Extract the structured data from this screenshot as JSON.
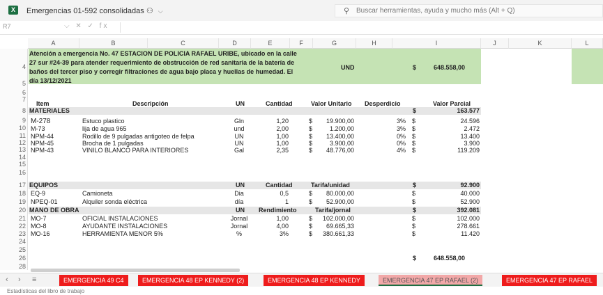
{
  "app": {
    "icon": "excel-icon",
    "doc_title": "Emergencias 01-592 consolidadas",
    "sync_icon": "people-sync-icon",
    "search_placeholder": "Buscar herramientas, ayuda y mucho más (Alt + Q)",
    "name_box": "R7",
    "formula_buttons": "⌵ ✕ ✓ fx"
  },
  "columns": [
    "A",
    "B",
    "C",
    "D",
    "E",
    "F",
    "G",
    "H",
    "I",
    "J",
    "K",
    "L"
  ],
  "rows": [
    "4",
    "5",
    "6",
    "7",
    "8",
    "9",
    "10",
    "11",
    "12",
    "13",
    "14",
    "15",
    "16",
    "17",
    "18",
    "19",
    "20",
    "21",
    "22",
    "23",
    "24",
    "25",
    "26",
    "28"
  ],
  "header_block": {
    "description": "Atención a emergencia No. 47 ESTACION DE POLICIA RAFAEL URIBE, ubicado en la calle 27 sur #24-39 para atender requerimiento de obstrucción de red sanitaria de la batería de baños del tercer piso y corregir filtraciones de agua bajo placa y huellas de humedad. El día 13/12/2021",
    "unit": "UND",
    "currency": "$",
    "total": "648.558,00"
  },
  "table_headers": {
    "item": "Item",
    "descripcion": "Descripción",
    "un": "UN",
    "cantidad": "Cantidad",
    "valor_unitario": "Valor Unitario",
    "desperdicio": "Desperdicio",
    "valor_parcial": "Valor Parcial"
  },
  "materiales": {
    "title": "MATERIALES",
    "currency": "$",
    "subtotal": "163.577",
    "items": [
      {
        "item": "M-278",
        "desc": "Estuco plastico",
        "un": "Gln",
        "cant": "1,20",
        "cur": "$",
        "vu": "19.900,00",
        "desp": "3%",
        "cur2": "$",
        "vp": "24.596"
      },
      {
        "item": "M-73",
        "desc": "lija de agua 965",
        "un": "und",
        "cant": "2,00",
        "cur": "$",
        "vu": "1.200,00",
        "desp": "3%",
        "cur2": "$",
        "vp": "2.472"
      },
      {
        "item": "NPM-44",
        "desc": "Rodillo de 9 pulgadas antigoteo de felpa",
        "un": "UN",
        "cant": "1,00",
        "cur": "$",
        "vu": "13.400,00",
        "desp": "0%",
        "cur2": "$",
        "vp": "13.400"
      },
      {
        "item": "NPM-45",
        "desc": "Brocha de 1 pulgadas",
        "un": "UN",
        "cant": "1,00",
        "cur": "$",
        "vu": "3.900,00",
        "desp": "0%",
        "cur2": "$",
        "vp": "3.900"
      },
      {
        "item": "NPM-43",
        "desc": "VINILO BLANCO PARA INTERIORES",
        "un": "Gal",
        "cant": "2,35",
        "cur": "$",
        "vu": "48.776,00",
        "desp": "4%",
        "cur2": "$",
        "vp": "119.209"
      }
    ]
  },
  "equipos": {
    "title": "EQUIPOS",
    "un": "UN",
    "cantidad": "Cantidad",
    "tarifa": "Tarifa/unidad",
    "currency": "$",
    "subtotal": "92.900",
    "items": [
      {
        "item": "EQ-9",
        "desc": "Camioneta",
        "un": "Dia",
        "cant": "0,5",
        "cur": "$",
        "vu": "80.000,00",
        "cur2": "$",
        "vp": "40.000"
      },
      {
        "item": "NPEQ-01",
        "desc": "Alquiler sonda eléctrica",
        "un": "día",
        "cant": "1",
        "cur": "$",
        "vu": "52.900,00",
        "cur2": "$",
        "vp": "52.900"
      }
    ]
  },
  "mano_obra": {
    "title": "MANO DE OBRA",
    "un": "UN",
    "rendimiento": "Rendimiento",
    "tarifa": "Tarifa/jornal",
    "currency": "$",
    "subtotal": "392.081",
    "items": [
      {
        "item": "MO-7",
        "desc": "OFICIAL INSTALACIONES",
        "un": "Jornal",
        "cant": "1,00",
        "cur": "$",
        "vu": "102.000,00",
        "cur2": "$",
        "vp": "102.000"
      },
      {
        "item": "MO-8",
        "desc": "AYUDANTE INSTALACIONES",
        "un": "Jornal",
        "cant": "4,00",
        "cur": "$",
        "vu": "69.665,33",
        "cur2": "$",
        "vp": "278.661"
      },
      {
        "item": "MO-16",
        "desc": "HERRAMIENTA MENOR 5%",
        "un": "%",
        "cant": "3%",
        "cur": "$",
        "vu": "380.661,33",
        "cur2": "$",
        "vp": "11.420"
      }
    ]
  },
  "grand_total": {
    "currency": "$",
    "value": "648.558,00"
  },
  "sheet_tabs": [
    {
      "label": "EMERGENCIA 49 C4",
      "active": false
    },
    {
      "label": "EMERGENCIA 48 EP KENNEDY (2)",
      "active": false
    },
    {
      "label": "EMERGENCIA 48 EP KENNEDY",
      "active": false
    },
    {
      "label": "EMERGENCIA 47 EP RAFAEL  (2)",
      "active": true
    },
    {
      "label": "EMERGENCIA 47 EP RAFAEL",
      "active": false
    }
  ],
  "status_bar": "Estadísticas del libro de trabajo",
  "colors": {
    "green": "#c5e3b4",
    "tab_red": "#ee1c1c",
    "tab_active": "#f2a8a8",
    "excel_green": "#1d6f42"
  }
}
